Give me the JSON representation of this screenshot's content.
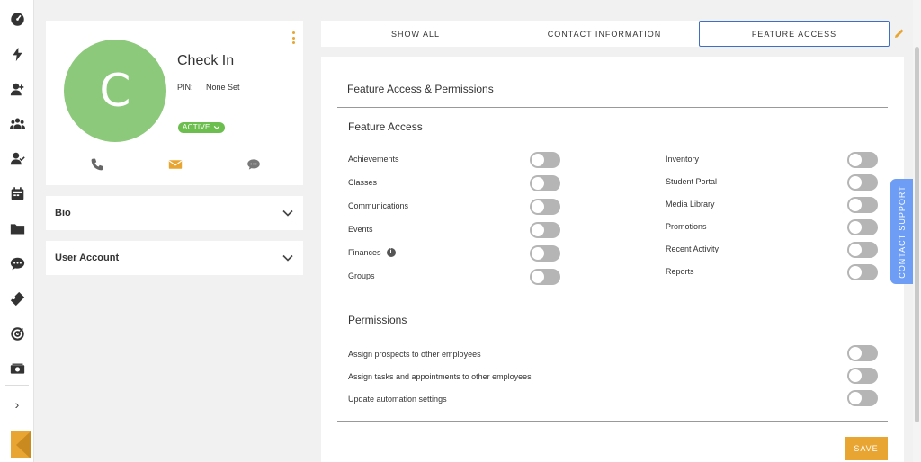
{
  "colors": {
    "accent": "#e8a532",
    "avatar": "#8cc97b",
    "active_badge": "#6cbf4f",
    "tab_border": "#3f6fc4",
    "support": "#6e9df5",
    "toggle_off": "#b5b5b5"
  },
  "rail": {
    "icons": [
      "dashboard-icon",
      "lightning-icon",
      "add-user-icon",
      "group-icon",
      "user-check-icon",
      "calendar-icon",
      "folder-icon",
      "chat-icon",
      "ticket-icon",
      "target-icon",
      "money-icon"
    ],
    "expand": "›"
  },
  "profile": {
    "initial": "C",
    "name": "Check In",
    "pin_label": "PIN:",
    "pin_value": "None Set",
    "status": "ACTIVE",
    "actions": [
      "phone-icon",
      "email-icon",
      "message-icon"
    ]
  },
  "accordions": [
    {
      "label": "Bio"
    },
    {
      "label": "User Account"
    }
  ],
  "tabs": [
    {
      "label": "SHOW ALL",
      "active": false
    },
    {
      "label": "CONTACT INFORMATION",
      "active": false
    },
    {
      "label": "FEATURE ACCESS",
      "active": true
    }
  ],
  "panel": {
    "title": "Feature Access & Permissions",
    "feature_section": "Feature Access",
    "features_left": [
      {
        "label": "Achievements",
        "enabled": false
      },
      {
        "label": "Classes",
        "enabled": false
      },
      {
        "label": "Communications",
        "enabled": false
      },
      {
        "label": "Events",
        "enabled": false
      },
      {
        "label": "Finances",
        "enabled": false,
        "info": true
      },
      {
        "label": "Groups",
        "enabled": false
      }
    ],
    "features_right": [
      {
        "label": "Inventory",
        "enabled": false
      },
      {
        "label": "Student Portal",
        "enabled": false
      },
      {
        "label": "Media Library",
        "enabled": false
      },
      {
        "label": "Promotions",
        "enabled": false
      },
      {
        "label": "Recent Activity",
        "enabled": false
      },
      {
        "label": "Reports",
        "enabled": false
      }
    ],
    "permissions_section": "Permissions",
    "permissions": [
      {
        "label": "Assign prospects to other employees",
        "enabled": false
      },
      {
        "label": "Assign tasks and appointments to other employees",
        "enabled": false
      },
      {
        "label": "Update automation settings",
        "enabled": false
      }
    ],
    "save_label": "SAVE"
  },
  "support_label": "CONTACT SUPPORT"
}
